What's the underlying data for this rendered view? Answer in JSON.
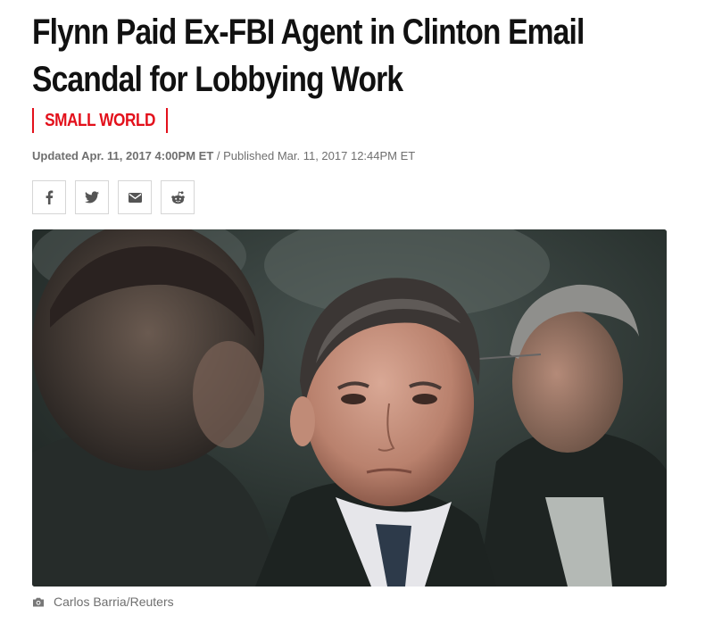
{
  "article": {
    "headline_line1": "Flynn Paid Ex-FBI Agent in Clinton Email",
    "headline_line2": "Scandal for Lobbying Work",
    "section": "SMALL WORLD",
    "updated": "Updated Apr. 11, 2017 4:00PM ET",
    "separator": " / ",
    "published": "Published Mar. 11, 2017 12:44PM ET",
    "photo_credit": "Carlos Barria/Reuters"
  },
  "share": {
    "buttons": [
      {
        "name": "facebook",
        "icon": "facebook-icon"
      },
      {
        "name": "twitter",
        "icon": "twitter-icon"
      },
      {
        "name": "email",
        "icon": "email-icon"
      },
      {
        "name": "reddit",
        "icon": "reddit-icon"
      }
    ]
  },
  "colors": {
    "accent": "#e3101b",
    "headline": "#111111",
    "meta": "#6f6f6f",
    "border": "#d6d6d6"
  }
}
